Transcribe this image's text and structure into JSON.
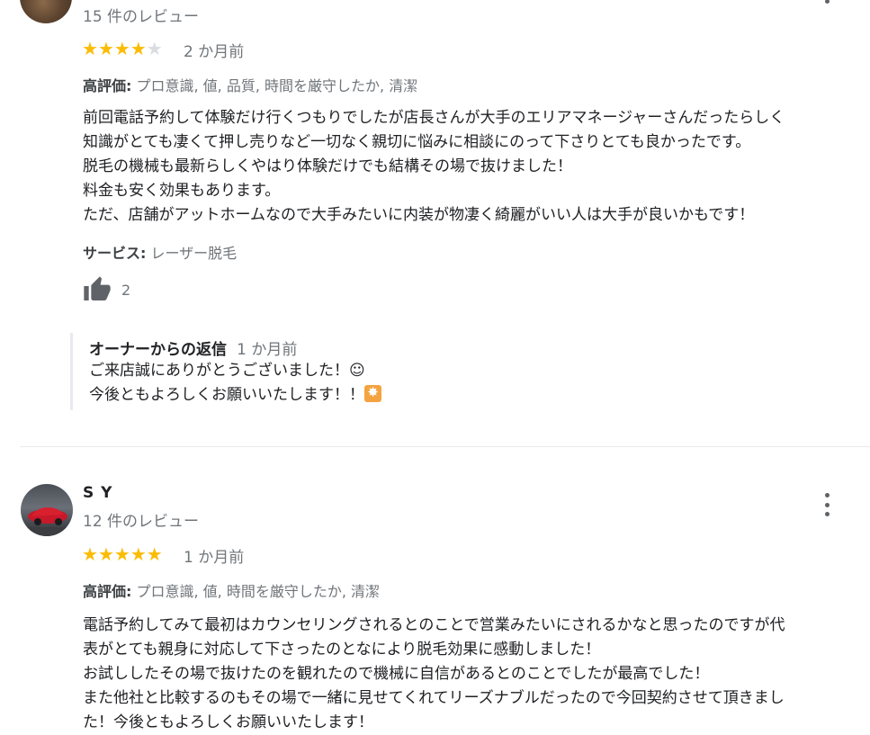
{
  "review1": {
    "reviewer_count": "15 件のレビュー",
    "rating": 4,
    "time_ago": "2 か月前",
    "aspects_label": "高評価:",
    "aspects_value": "プロ意識, 値, 品質, 時間を厳守したか, 清潔",
    "text": "前回電話予約して体験だけ行くつもりでしたが店長さんが大手のエリアマネージャーさんだったらしく\n知識がとても凄くて押し売りなど一切なく親切に悩みに相談にのって下さりとても良かったです。\n脱毛の機械も最新らしくやはり体験だけでも結構その場で抜けました！\n料金も安く効果もあります。\nただ、店舗がアットホームなので大手みたいに内装が物凄く綺麗がいい人は大手が良いかもです！",
    "service_label": "サービス:",
    "service_value": "レーザー脱毛",
    "likes": "2",
    "owner_reply": {
      "title": "オーナーからの返信",
      "time_ago": "1 か月前",
      "line1": "ご来店誠にありがとうございました！☺",
      "line2": "今後ともよろしくお願いいたします！！"
    }
  },
  "review2": {
    "name": "S Y",
    "reviewer_count": "12 件のレビュー",
    "rating": 5,
    "time_ago": "1 か月前",
    "aspects_label": "高評価:",
    "aspects_value": "プロ意識, 値, 時間を厳守したか, 清潔",
    "text": "電話予約してみて最初はカウンセリングされるとのことで営業みたいにされるかなと思ったのですが代\n表がとても親身に対応して下さったのとなにより脱毛効果に感動しました！\nお試ししたその場で抜けたのを観れたので機械に自信があるとのことでしたが最高でした！\nまた他社と比較するのもその場で一緒に見せてくれてリーズナブルだったので今回契約させて頂きまし\nた！今後ともよろしくお願いいたします！"
  },
  "colors": {
    "star_on": "#fbbc04",
    "star_off": "#dadce0",
    "muted_text": "#70757a"
  }
}
